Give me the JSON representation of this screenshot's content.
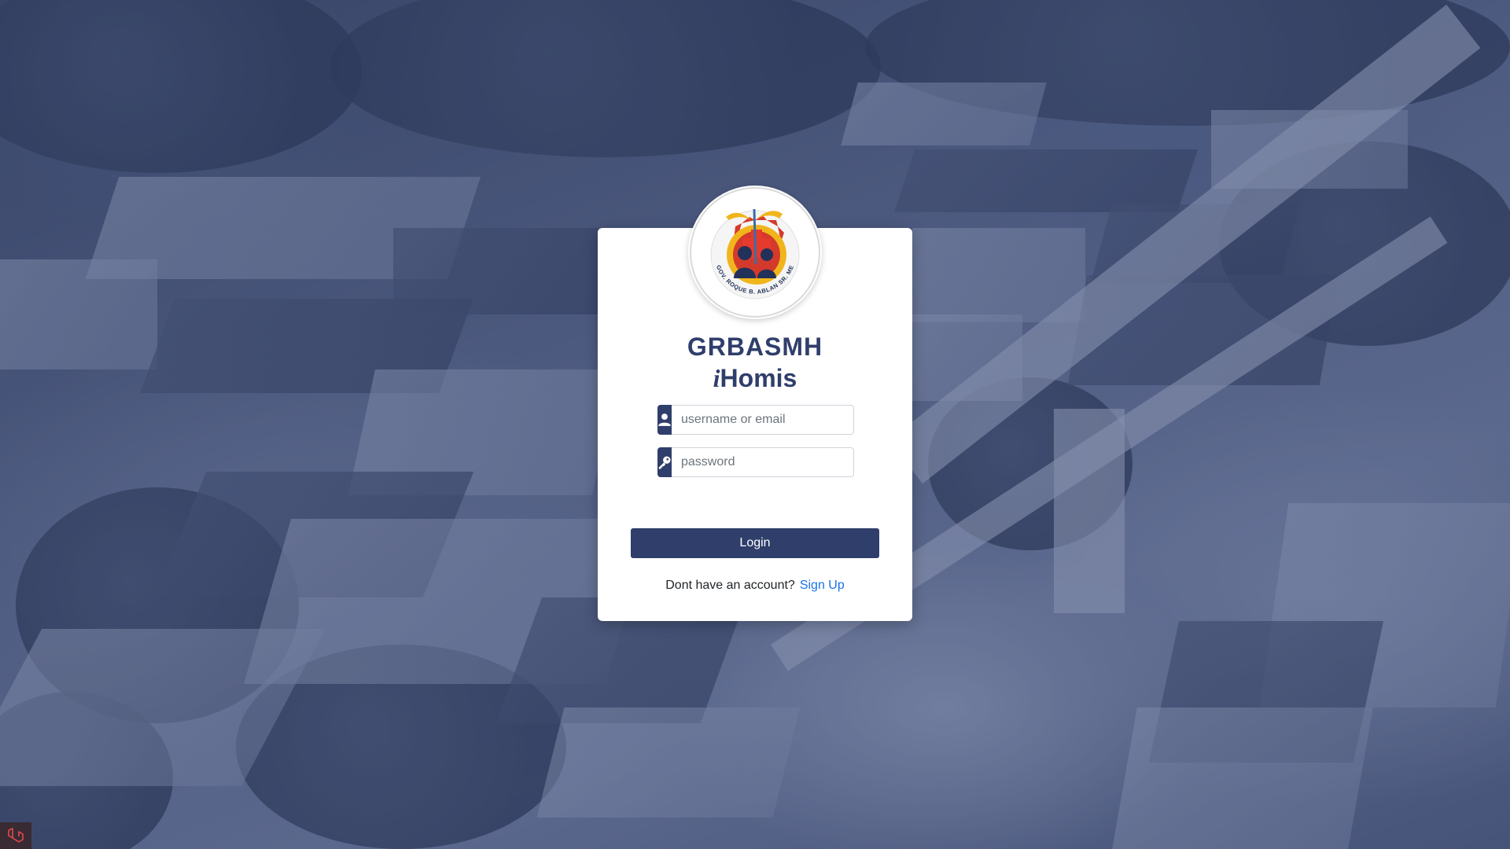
{
  "background": {
    "description_color": "#3c4868",
    "overlay_color": "#283764"
  },
  "logo": {
    "icon": "hospital-seal-logo",
    "seal_text": "GOV. ROQUE B. ABLAN SR. MEMORIAL HOSPITAL"
  },
  "brand": {
    "line1": "GRBASMH",
    "line2_prefix": "i",
    "line2_rest": "Homis"
  },
  "form": {
    "username": {
      "icon": "user-icon",
      "placeholder": "username or email",
      "value": ""
    },
    "password": {
      "icon": "key-icon",
      "placeholder": "password",
      "value": ""
    },
    "login_label": "Login"
  },
  "signup": {
    "prompt": "Dont have an account?",
    "link_label": "Sign Up"
  },
  "colors": {
    "primary": "#2f3e6b",
    "link": "#1a73e8",
    "card": "#ffffff"
  },
  "corner_badge": {
    "icon": "laravel-icon"
  }
}
